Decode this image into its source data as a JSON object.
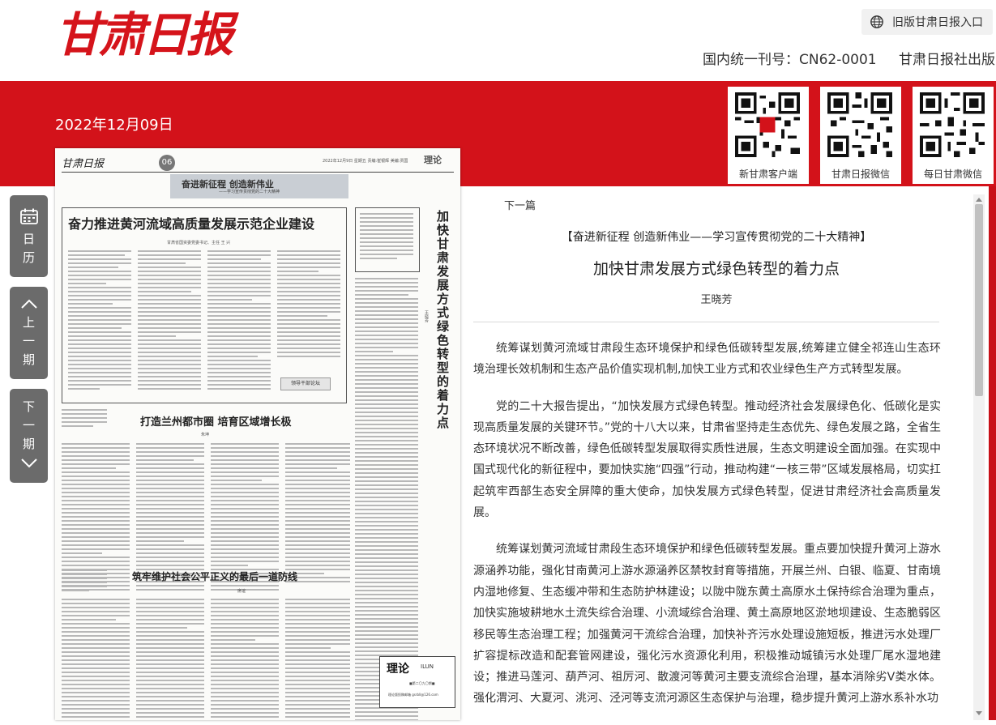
{
  "header": {
    "logo_text": "甘肃日报",
    "old_version_link": "旧版甘肃日报入口",
    "cn_number": "国内统一刊号：CN62-0001",
    "publisher": "甘肃日报社出版"
  },
  "date": "2022年12月09日",
  "qr_codes": [
    {
      "caption": "新甘肃客户端",
      "icon": "qr-code-icon"
    },
    {
      "caption": "甘肃日报微信",
      "icon": "qr-code-icon"
    },
    {
      "caption": "每日甘肃微信",
      "icon": "qr-code-icon"
    }
  ],
  "side_nav": {
    "calendar": "日历",
    "prev_issue": "上一期",
    "next_issue": "下一期"
  },
  "newspaper": {
    "masthead": "甘肃日报",
    "page_number": "06",
    "page_date": "2022年12月9日 星期五 责编:崔银辉 美编:贾国",
    "section": "理论",
    "banner_line1": "奋进新征程 创造新伟业",
    "banner_line2": "——学习宣传贯彻党的二十大精神",
    "headline1": "奋力推进黄河流域高质量发展示范企业建设",
    "byline1": "甘肃省国资委党委书记、主任 王 兴",
    "vertical_headline": "加快甘肃发展方式绿色转型的着力点",
    "vertical_author": "王晓芳",
    "tag": "领导干部论坛",
    "headline2": "打造兰州都市圈 培育区域增长极",
    "byline2": "朱坤",
    "headline3": "筑牢维护社会公平正义的最后一道防线",
    "byline3": "席谊",
    "box_title": "理论",
    "box_subtitle": "ILUN",
    "box_line1": "■第二〇九〇期■",
    "box_line2": "理论版投稿邮箱 gsrbll@126.com"
  },
  "article": {
    "nav_next": "下一篇",
    "column": "【奋进新征程 创造新伟业——学习宣传贯彻党的二十大精神】",
    "title": "加快甘肃发展方式绿色转型的着力点",
    "author": "王晓芳",
    "paragraphs": [
      "统筹谋划黄河流域甘肃段生态环境保护和绿色低碳转型发展,统筹建立健全祁连山生态环境治理长效机制和生态产品价值实现机制,加快工业方式和农业绿色生产方式转型发展。",
      "党的二十大报告提出，“加快发展方式绿色转型。推动经济社会发展绿色化、低碳化是实现高质量发展的关键环节。”党的十八大以来，甘肃省坚持走生态优先、绿色发展之路，全省生态环境状况不断改善，绿色低碳转型发展取得实质性进展，生态文明建设全面加强。在实现中国式现代化的新征程中，要加快实施“四强”行动，推动构建“一核三带”区域发展格局，切实扛起筑牢西部生态安全屏障的重大使命，加快发展方式绿色转型，促进甘肃经济社会高质量发展。",
      "统筹谋划黄河流域甘肃段生态环境保护和绿色低碳转型发展。重点要加快提升黄河上游水源涵养功能，强化甘南黄河上游水源涵养区禁牧封育等措施，开展兰州、白银、临夏、甘南境内湿地修复、生态缓冲带和生态防护林建设；以陇中陇东黄土高原水土保持综合治理为重点，加快实施坡耕地水土流失综合治理、小流域综合治理、黄土高原地区淤地坝建设、生态脆弱区移民等生态治理工程；加强黄河干流综合治理，加快补齐污水处理设施短板，推进污水处理厂扩容提标改造和配套管网建设，强化污水资源化利用，积极推动城镇污水处理厂尾水湿地建设；推进马莲河、葫芦河、祖厉河、散渡河等黄河主要支流综合治理，基本消除劣Ⅴ类水体。强化渭河、大夏河、洮河、泾河等支流河源区生态保护与治理，稳步提升黄河上游水系补水功"
    ]
  },
  "colors": {
    "brand_red": "#d3121a",
    "nav_gray": "#6b6b6b"
  }
}
